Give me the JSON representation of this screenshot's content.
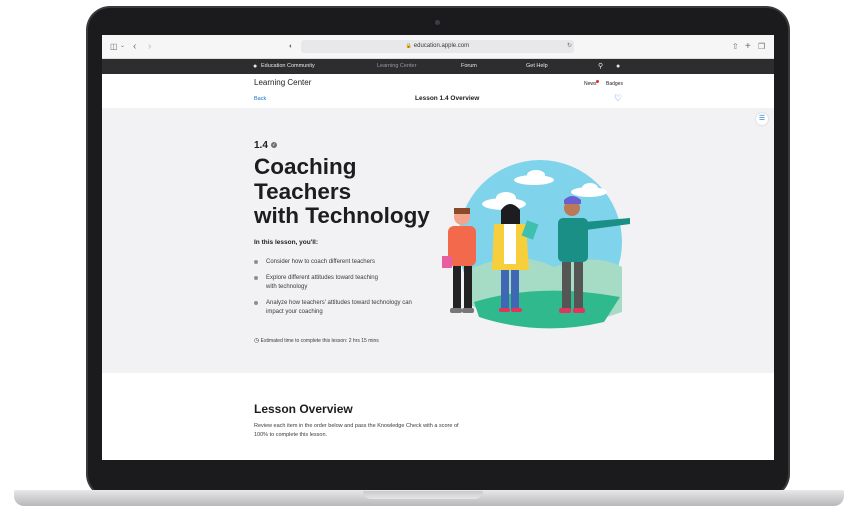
{
  "browser": {
    "url": "education.apple.com"
  },
  "global_nav": {
    "brand": "Education Community",
    "links": [
      "Learning Center",
      "Forum",
      "Get Help"
    ]
  },
  "local_nav": {
    "title": "Learning Center",
    "news": "News",
    "badges": "Badges"
  },
  "sub_nav": {
    "back": "Back",
    "title": "Lesson 1.4 Overview"
  },
  "hero": {
    "lesson_number": "1.4",
    "title_lines": [
      "Coaching",
      "Teachers",
      "with Technology"
    ],
    "intro": "In this lesson, you'll:",
    "bullets": [
      [
        "Consider how to coach different teachers"
      ],
      [
        "Explore different attitudes toward teaching",
        "with technology"
      ],
      [
        "Analyze how teachers' attitudes toward technology can",
        "impact your coaching"
      ]
    ],
    "estimate": "Estimated time to complete this lesson: 2 hrs 15 mins"
  },
  "overview": {
    "heading": "Lesson Overview",
    "body_lines": [
      "Review each item in the order below and pass the Knowledge Check with a score of",
      "100% to complete this lesson."
    ]
  },
  "colors": {
    "link_blue": "#0a6fd6",
    "hero_bg": "#f2f2f5",
    "gnav_bg": "#2d2d2f",
    "illustration_sky": "#7fd3ea"
  }
}
